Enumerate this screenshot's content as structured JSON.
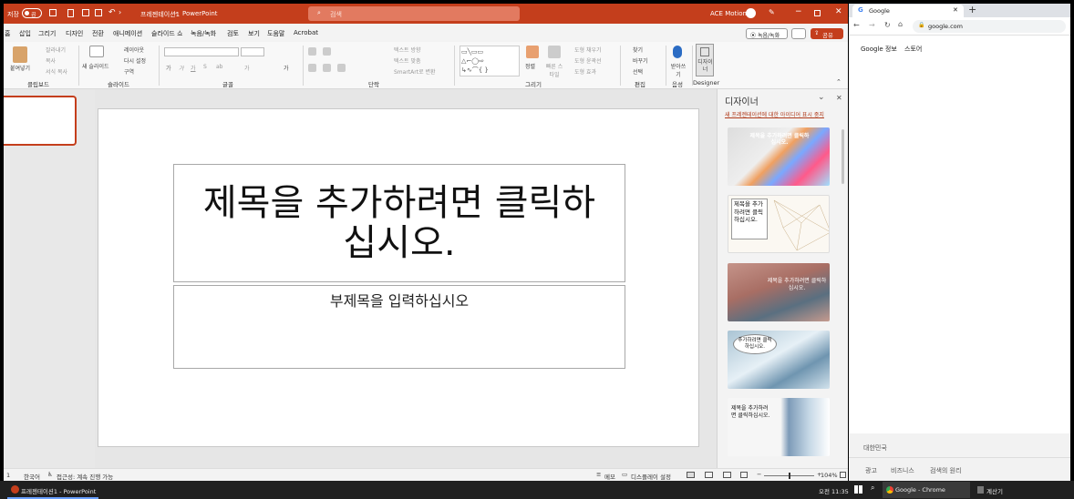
{
  "ppt": {
    "autosave_label": "저장",
    "autosave_state": "끔",
    "doc_title": "프레젠테이션1",
    "app_name": "PowerPoint",
    "search_placeholder": "검색",
    "user_name": "ACE Motion",
    "tabs": [
      "홈",
      "삽입",
      "그리기",
      "디자인",
      "전환",
      "애니메이션",
      "슬라이드 쇼",
      "녹음/녹화",
      "검토",
      "보기",
      "도움말",
      "Acrobat"
    ],
    "record_button": "녹음/녹화",
    "share_button": "공유",
    "ribbon": {
      "clipboard": {
        "paste": "붙여넣기",
        "cut": "잘라내기",
        "copy": "복사",
        "format_painter": "서식 복사",
        "group": "클립보드"
      },
      "slides": {
        "new_slide": "새 슬라이드",
        "layout": "레이아웃",
        "reset": "다시 설정",
        "section": "구역",
        "group": "슬라이드"
      },
      "font": {
        "group": "글꼴",
        "bold": "가",
        "italic": "가",
        "underline": "가",
        "strike": "S",
        "spacing": "ab",
        "font_color": "가",
        "case": "가"
      },
      "paragraph": {
        "group": "단락",
        "text_direction": "텍스트 방향",
        "align_text": "텍스트 맞춤",
        "smartart": "SmartArt로 변환"
      },
      "drawing": {
        "group": "그리기",
        "arrange": "정렬",
        "quick_styles": "빠른 스타일",
        "fill": "도형 채우기",
        "outline": "도형 윤곽선",
        "effects": "도형 효과"
      },
      "editing": {
        "group": "편집",
        "find": "찾기",
        "replace": "바꾸기",
        "select": "선택"
      },
      "voice": {
        "group": "음성",
        "dictate": "받아쓰기"
      },
      "designer": {
        "group": "Designer",
        "label": "디자이너"
      }
    },
    "slide": {
      "title_line1": "제목을 추가하려면 클릭하",
      "title_line2": "십시오.",
      "subtitle": "부제목을 입력하십시오"
    },
    "designer_pane": {
      "title": "디자이너",
      "link": "새 프레젠테이션에 대한 아이디어 표시 중지",
      "cards": [
        {
          "text": "제목을 추가하려면 클릭하십시오."
        },
        {
          "text": "제목을 추가하려면 클릭하십시오."
        },
        {
          "text": "제목을 추가하려면 클릭하십시오."
        },
        {
          "text": "추가하려면 클릭하십시오."
        },
        {
          "text": "제목을 추가하려면 클릭하십시오."
        }
      ]
    },
    "status": {
      "slide_no": "1",
      "language": "한국어",
      "accessibility": "접근성: 계속 진행 가능",
      "notes": "메모",
      "display_settings": "디스플레이 설정",
      "zoom": "104%"
    }
  },
  "chrome": {
    "tab_title": "Google",
    "url": "google.com",
    "links_left": [
      "Google 정보",
      "스토어"
    ],
    "footer_country": "대한민국",
    "footer_links": [
      "광고",
      "비즈니스",
      "검색의 원리"
    ]
  },
  "taskbar": {
    "ppt_item": "프레젠테이션1 - PowerPoint",
    "time": "오전 11:35",
    "chrome_item": "Google - Chrome",
    "calc_item": "계산기"
  },
  "colors": {
    "ppt_accent": "#c43e1c",
    "chrome_tabbar": "#dee1e6",
    "taskbar": "#202020"
  }
}
